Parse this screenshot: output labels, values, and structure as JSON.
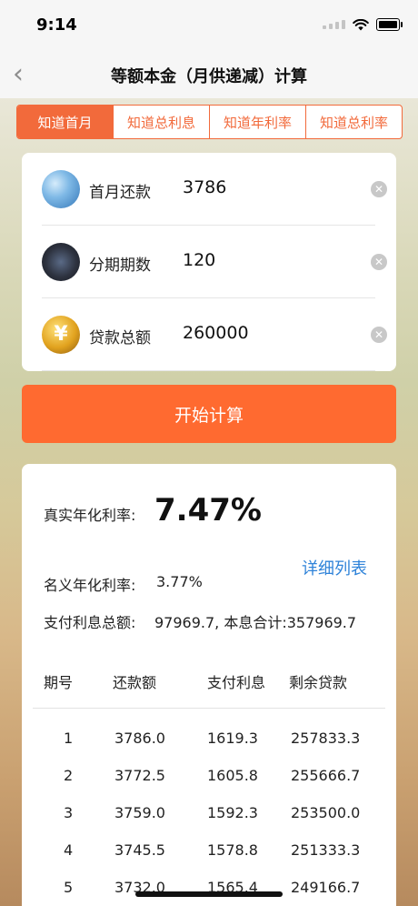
{
  "status": {
    "time": "9:14"
  },
  "nav": {
    "title": "等额本金（月供递减）计算",
    "back_glyph": "‹"
  },
  "tabs": [
    {
      "label": "知道首月",
      "selected": true
    },
    {
      "label": "知道总利息",
      "selected": false
    },
    {
      "label": "知道年利率",
      "selected": false
    },
    {
      "label": "知道总利率",
      "selected": false
    }
  ],
  "form": [
    {
      "icon": "globe-icon",
      "label": "首月还款",
      "value": "3786"
    },
    {
      "icon": "calendar-photo-icon",
      "label": "分期期数",
      "value": "120"
    },
    {
      "icon": "yuan-coin-icon",
      "label": "贷款总额",
      "value": "260000"
    }
  ],
  "calc_button": "开始计算",
  "result": {
    "real_rate_label": "真实年化利率:",
    "real_rate_value": "7.47%",
    "detail_link": "详细列表",
    "nominal_rate_label": "名义年化利率:",
    "nominal_rate_value": "3.77%",
    "interest_label": "支付利息总额:",
    "interest_value": "97969.7, 本息合计:357969.7"
  },
  "table": {
    "headers": [
      "期号",
      "还款额",
      "支付利息",
      "剩余贷款"
    ],
    "rows": [
      [
        "1",
        "3786.0",
        "1619.3",
        "257833.3"
      ],
      [
        "2",
        "3772.5",
        "1605.8",
        "255666.7"
      ],
      [
        "3",
        "3759.0",
        "1592.3",
        "253500.0"
      ],
      [
        "4",
        "3745.5",
        "1578.8",
        "251333.3"
      ],
      [
        "5",
        "3732.0",
        "1565.4",
        "249166.7"
      ]
    ]
  },
  "colors": {
    "accent": "#f26a3b",
    "button": "#ff6a30",
    "link": "#2f83d9"
  }
}
